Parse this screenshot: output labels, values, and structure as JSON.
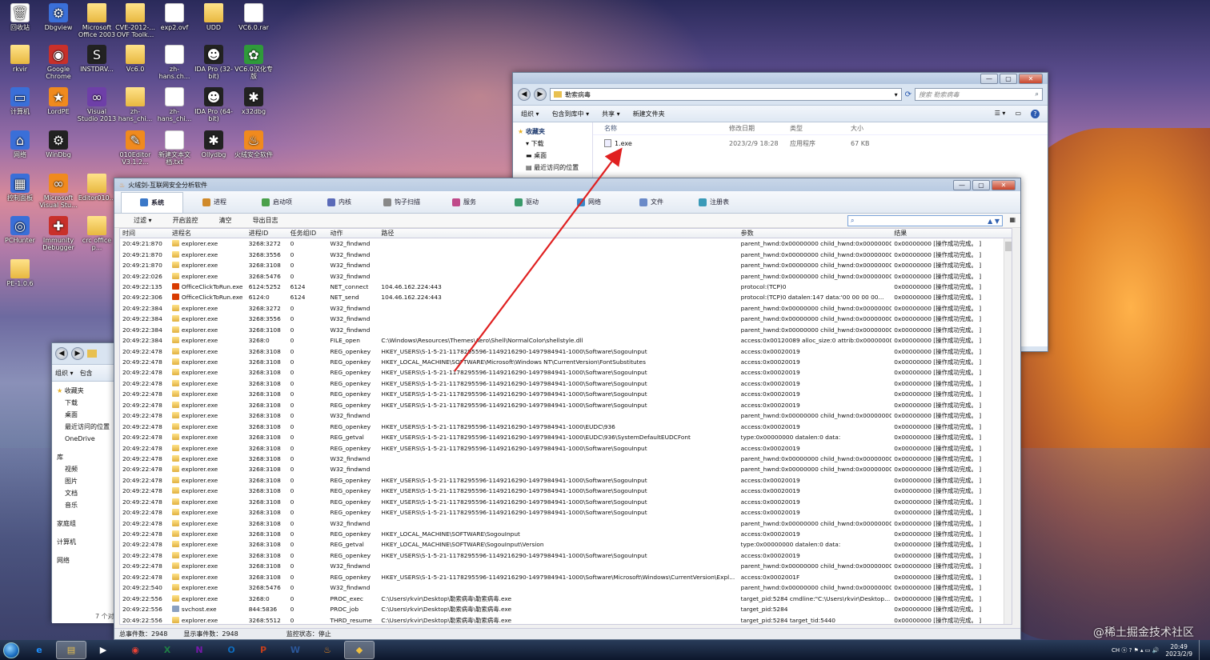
{
  "desktop": {
    "icons": [
      {
        "label": "回收站",
        "icon": "recycle-bin-icon",
        "cls": "file",
        "glyph": "🗑"
      },
      {
        "label": "Dbgview",
        "icon": "dbgview-icon",
        "cls": "app",
        "glyph": "⚙"
      },
      {
        "label": "Microsoft Office 2003",
        "icon": "folder-icon",
        "cls": "folder",
        "glyph": ""
      },
      {
        "label": "CVE-2012-... OVF Toolk...",
        "icon": "folder-icon",
        "cls": "folder",
        "glyph": ""
      },
      {
        "label": "exp2.ovf",
        "icon": "file-icon",
        "cls": "file",
        "glyph": ""
      },
      {
        "label": "UDD",
        "icon": "folder-icon",
        "cls": "folder",
        "glyph": ""
      },
      {
        "label": "VC6.0.rar",
        "icon": "file-icon",
        "cls": "file",
        "glyph": ""
      },
      {
        "label": "rkvir",
        "icon": "user-folder-icon",
        "cls": "folder",
        "glyph": ""
      },
      {
        "label": "Google Chrome",
        "icon": "chrome-icon",
        "cls": "red",
        "glyph": "◉"
      },
      {
        "label": "INSTDRV...",
        "icon": "instdrv-icon",
        "cls": "dark",
        "glyph": "S"
      },
      {
        "label": "Vc6.0",
        "icon": "folder-icon",
        "cls": "folder",
        "glyph": ""
      },
      {
        "label": "zh-hans.ch...",
        "icon": "file-icon",
        "cls": "file",
        "glyph": ""
      },
      {
        "label": "IDA Pro (32-bit)",
        "icon": "ida-icon",
        "cls": "dark",
        "glyph": "☻"
      },
      {
        "label": "VC6.0汉化专版",
        "icon": "vc6-icon",
        "cls": "green",
        "glyph": "✿"
      },
      {
        "label": "计算机",
        "icon": "computer-icon",
        "cls": "app",
        "glyph": "▭"
      },
      {
        "label": "LordPE",
        "icon": "lordpe-icon",
        "cls": "orange",
        "glyph": "★"
      },
      {
        "label": "Visual Studio 2013",
        "icon": "visual-studio-icon",
        "cls": "purple",
        "glyph": "∞"
      },
      {
        "label": "zh-hans_chi...",
        "icon": "folder-icon",
        "cls": "folder",
        "glyph": ""
      },
      {
        "label": "zh-hans_chi...",
        "icon": "file-icon",
        "cls": "file",
        "glyph": ""
      },
      {
        "label": "IDA Pro (64-bit)",
        "icon": "ida-icon",
        "cls": "dark",
        "glyph": "☻"
      },
      {
        "label": "x32dbg",
        "icon": "x32dbg-icon",
        "cls": "dark",
        "glyph": "✱"
      },
      {
        "label": "网络",
        "icon": "network-icon",
        "cls": "app",
        "glyph": "⌂"
      },
      {
        "label": "WinDbg",
        "icon": "windbg-icon",
        "cls": "dark",
        "glyph": "⚙"
      },
      {
        "label": "010Editor V3.1.2...",
        "icon": "010editor-icon",
        "cls": "orange",
        "glyph": "✎"
      },
      {
        "label": "新建文本文档.txt",
        "icon": "file-icon",
        "cls": "file",
        "glyph": ""
      },
      {
        "label": "Ollydbg",
        "icon": "ollydbg-icon",
        "cls": "dark",
        "glyph": "✱"
      },
      {
        "label": "火绒安全软件",
        "icon": "huorong-icon",
        "cls": "orange",
        "glyph": "♨"
      },
      {
        "label": "控制面板",
        "icon": "control-panel-icon",
        "cls": "app",
        "glyph": "▦"
      },
      {
        "label": "Microsoft Visual Stu...",
        "icon": "vs-icon",
        "cls": "orange",
        "glyph": "∞"
      },
      {
        "label": "Editor010...",
        "icon": "folder-icon",
        "cls": "folder",
        "glyph": ""
      },
      {
        "label": "PCHunter",
        "icon": "pchunter-icon",
        "cls": "app",
        "glyph": "◎"
      },
      {
        "label": "Immunity Debugger",
        "icon": "immunity-icon",
        "cls": "red",
        "glyph": "✚"
      },
      {
        "label": "crc office p...",
        "icon": "folder-icon",
        "cls": "folder",
        "glyph": ""
      },
      {
        "label": "PE-1.0.6",
        "icon": "folder-icon",
        "cls": "folder",
        "glyph": ""
      }
    ]
  },
  "explorer": {
    "address": "勒索病毒",
    "search_placeholder": "搜索 勒索病毒",
    "cmd": [
      "组织 ▾",
      "包含到库中 ▾",
      "共享 ▾",
      "新建文件夹"
    ],
    "nav": {
      "fav": "收藏夹",
      "items": [
        "下载",
        "桌面",
        "最近访问的位置"
      ]
    },
    "headers": [
      "名称",
      "修改日期",
      "类型",
      "大小"
    ],
    "files": [
      {
        "name": "1.exe",
        "date": "2023/2/9 18:28",
        "type": "应用程序",
        "size": "67 KB"
      }
    ]
  },
  "explorer2": {
    "cmd": [
      "组织 ▾",
      "包含"
    ],
    "nav": {
      "fav": "收藏夹",
      "items": [
        "下载",
        "桌面",
        "最近访问的位置",
        "OneDrive"
      ],
      "lib": "库",
      "libitems": [
        "视频",
        "图片",
        "文档",
        "音乐"
      ],
      "homegroup": "家庭组",
      "computer": "计算机",
      "network": "网络"
    },
    "count": "7 个对"
  },
  "tool": {
    "title": "火绒剑-互联网安全分析软件",
    "tabs": [
      {
        "label": "系统",
        "color": "#3a78c8"
      },
      {
        "label": "进程",
        "color": "#d08a2a"
      },
      {
        "label": "启动项",
        "color": "#4aa04a"
      },
      {
        "label": "内核",
        "color": "#5a6ab8"
      },
      {
        "label": "钩子扫描",
        "color": "#888888"
      },
      {
        "label": "服务",
        "color": "#c04a8a"
      },
      {
        "label": "驱动",
        "color": "#3a9a6a"
      },
      {
        "label": "网络",
        "color": "#3a88c8"
      },
      {
        "label": "文件",
        "color": "#6a8ac8"
      },
      {
        "label": "注册表",
        "color": "#3a9ab8"
      }
    ],
    "toolbar": [
      "过滤 ▾",
      "开启监控",
      "清空",
      "导出日志"
    ],
    "columns": [
      "时间",
      "进程名",
      "进程ID",
      "任务组ID",
      "动作",
      "路径",
      "参数",
      "结果"
    ],
    "rows": [
      [
        "20:49:21:870",
        "explorer.exe",
        "3268:3272",
        "0",
        "W32_findwnd",
        "",
        "parent_hwnd:0x00000000 child_hwnd:0x00000000...",
        "0x00000000 [操作成功完成。 ]",
        "folder"
      ],
      [
        "20:49:21:870",
        "explorer.exe",
        "3268:3556",
        "0",
        "W32_findwnd",
        "",
        "parent_hwnd:0x00000000 child_hwnd:0x00000000...",
        "0x00000000 [操作成功完成。 ]",
        "folder"
      ],
      [
        "20:49:21:870",
        "explorer.exe",
        "3268:3108",
        "0",
        "W32_findwnd",
        "",
        "parent_hwnd:0x00000000 child_hwnd:0x00000000...",
        "0x00000000 [操作成功完成。 ]",
        "folder"
      ],
      [
        "20:49:22:026",
        "explorer.exe",
        "3268:5476",
        "0",
        "W32_findwnd",
        "",
        "parent_hwnd:0x00000000 child_hwnd:0x00000000...",
        "0x00000000 [操作成功完成。 ]",
        "folder"
      ],
      [
        "20:49:22:135",
        "OfficeClickToRun.exe",
        "6124:5252",
        "6124",
        "NET_connect",
        "104.46.162.224:443",
        "protocol:(TCP)0",
        "0x00000000 [操作成功完成。 ]",
        "office"
      ],
      [
        "20:49:22:306",
        "OfficeClickToRun.exe",
        "6124:0",
        "6124",
        "NET_send",
        "104.46.162.224:443",
        "protocol:(TCP)0 datalen:147 data:'00 00 00 00...",
        "0x00000000 [操作成功完成。 ]",
        "office"
      ],
      [
        "20:49:22:384",
        "explorer.exe",
        "3268:3272",
        "0",
        "W32_findwnd",
        "",
        "parent_hwnd:0x00000000 child_hwnd:0x00000000...",
        "0x00000000 [操作成功完成。 ]",
        "folder"
      ],
      [
        "20:49:22:384",
        "explorer.exe",
        "3268:3556",
        "0",
        "W32_findwnd",
        "",
        "parent_hwnd:0x00000000 child_hwnd:0x00000000...",
        "0x00000000 [操作成功完成。 ]",
        "folder"
      ],
      [
        "20:49:22:384",
        "explorer.exe",
        "3268:3108",
        "0",
        "W32_findwnd",
        "",
        "parent_hwnd:0x00000000 child_hwnd:0x00000000...",
        "0x00000000 [操作成功完成。 ]",
        "folder"
      ],
      [
        "20:49:22:384",
        "explorer.exe",
        "3268:0",
        "0",
        "FILE_open",
        "C:\\Windows\\Resources\\Themes\\Aero\\Shell\\NormalColor\\shellstyle.dll",
        "access:0x00120089 alloc_size:0 attrib:0x00000000...",
        "0x00000000 [操作成功完成。 ]",
        "folder"
      ],
      [
        "20:49:22:478",
        "explorer.exe",
        "3268:3108",
        "0",
        "REG_openkey",
        "HKEY_USERS\\S-1-5-21-1178295596-1149216290-1497984941-1000\\Software\\SogouInput",
        "access:0x00020019",
        "0x00000000 [操作成功完成。 ]",
        "folder"
      ],
      [
        "20:49:22:478",
        "explorer.exe",
        "3268:3108",
        "0",
        "REG_openkey",
        "HKEY_LOCAL_MACHINE\\SOFTWARE\\Microsoft\\Windows NT\\CurrentVersion\\FontSubstitutes",
        "access:0x00020019",
        "0x00000000 [操作成功完成。 ]",
        "folder"
      ],
      [
        "20:49:22:478",
        "explorer.exe",
        "3268:3108",
        "0",
        "REG_openkey",
        "HKEY_USERS\\S-1-5-21-1178295596-1149216290-1497984941-1000\\Software\\SogouInput",
        "access:0x00020019",
        "0x00000000 [操作成功完成。 ]",
        "folder"
      ],
      [
        "20:49:22:478",
        "explorer.exe",
        "3268:3108",
        "0",
        "REG_openkey",
        "HKEY_USERS\\S-1-5-21-1178295596-1149216290-1497984941-1000\\Software\\SogouInput",
        "access:0x00020019",
        "0x00000000 [操作成功完成。 ]",
        "folder"
      ],
      [
        "20:49:22:478",
        "explorer.exe",
        "3268:3108",
        "0",
        "REG_openkey",
        "HKEY_USERS\\S-1-5-21-1178295596-1149216290-1497984941-1000\\Software\\SogouInput",
        "access:0x00020019",
        "0x00000000 [操作成功完成。 ]",
        "folder"
      ],
      [
        "20:49:22:478",
        "explorer.exe",
        "3268:3108",
        "0",
        "REG_openkey",
        "HKEY_USERS\\S-1-5-21-1178295596-1149216290-1497984941-1000\\Software\\SogouInput",
        "access:0x00020019",
        "0x00000000 [操作成功完成。 ]",
        "folder"
      ],
      [
        "20:49:22:478",
        "explorer.exe",
        "3268:3108",
        "0",
        "W32_findwnd",
        "",
        "parent_hwnd:0x00000000 child_hwnd:0x00000000...",
        "0x00000000 [操作成功完成。 ]",
        "folder"
      ],
      [
        "20:49:22:478",
        "explorer.exe",
        "3268:3108",
        "0",
        "REG_openkey",
        "HKEY_USERS\\S-1-5-21-1178295596-1149216290-1497984941-1000\\EUDC\\936",
        "access:0x00020019",
        "0x00000000 [操作成功完成。 ]",
        "folder"
      ],
      [
        "20:49:22:478",
        "explorer.exe",
        "3268:3108",
        "0",
        "REG_getval",
        "HKEY_USERS\\S-1-5-21-1178295596-1149216290-1497984941-1000\\EUDC\\936\\SystemDefaultEUDCFont",
        "type:0x00000000 datalen:0 data:",
        "0x00000000 [操作成功完成。 ]",
        "folder"
      ],
      [
        "20:49:22:478",
        "explorer.exe",
        "3268:3108",
        "0",
        "REG_openkey",
        "HKEY_USERS\\S-1-5-21-1178295596-1149216290-1497984941-1000\\Software\\SogouInput",
        "access:0x00020019",
        "0x00000000 [操作成功完成。 ]",
        "folder"
      ],
      [
        "20:49:22:478",
        "explorer.exe",
        "3268:3108",
        "0",
        "W32_findwnd",
        "",
        "parent_hwnd:0x00000000 child_hwnd:0x00000000...",
        "0x00000000 [操作成功完成。 ]",
        "folder"
      ],
      [
        "20:49:22:478",
        "explorer.exe",
        "3268:3108",
        "0",
        "W32_findwnd",
        "",
        "parent_hwnd:0x00000000 child_hwnd:0x00000000...",
        "0x00000000 [操作成功完成。 ]",
        "folder"
      ],
      [
        "20:49:22:478",
        "explorer.exe",
        "3268:3108",
        "0",
        "REG_openkey",
        "HKEY_USERS\\S-1-5-21-1178295596-1149216290-1497984941-1000\\Software\\SogouInput",
        "access:0x00020019",
        "0x00000000 [操作成功完成。 ]",
        "folder"
      ],
      [
        "20:49:22:478",
        "explorer.exe",
        "3268:3108",
        "0",
        "REG_openkey",
        "HKEY_USERS\\S-1-5-21-1178295596-1149216290-1497984941-1000\\Software\\SogouInput",
        "access:0x00020019",
        "0x00000000 [操作成功完成。 ]",
        "folder"
      ],
      [
        "20:49:22:478",
        "explorer.exe",
        "3268:3108",
        "0",
        "REG_openkey",
        "HKEY_USERS\\S-1-5-21-1178295596-1149216290-1497984941-1000\\Software\\SogouInput",
        "access:0x00020019",
        "0x00000000 [操作成功完成。 ]",
        "folder"
      ],
      [
        "20:49:22:478",
        "explorer.exe",
        "3268:3108",
        "0",
        "REG_openkey",
        "HKEY_USERS\\S-1-5-21-1178295596-1149216290-1497984941-1000\\Software\\SogouInput",
        "access:0x00020019",
        "0x00000000 [操作成功完成。 ]",
        "folder"
      ],
      [
        "20:49:22:478",
        "explorer.exe",
        "3268:3108",
        "0",
        "W32_findwnd",
        "",
        "parent_hwnd:0x00000000 child_hwnd:0x00000000...",
        "0x00000000 [操作成功完成。 ]",
        "folder"
      ],
      [
        "20:49:22:478",
        "explorer.exe",
        "3268:3108",
        "0",
        "REG_openkey",
        "HKEY_LOCAL_MACHINE\\SOFTWARE\\SogouInput",
        "access:0x00020019",
        "0x00000000 [操作成功完成。 ]",
        "folder"
      ],
      [
        "20:49:22:478",
        "explorer.exe",
        "3268:3108",
        "0",
        "REG_getval",
        "HKEY_LOCAL_MACHINE\\SOFTWARE\\SogouInput\\Version",
        "type:0x00000000 datalen:0 data:",
        "0x00000000 [操作成功完成。 ]",
        "folder"
      ],
      [
        "20:49:22:478",
        "explorer.exe",
        "3268:3108",
        "0",
        "REG_openkey",
        "HKEY_USERS\\S-1-5-21-1178295596-1149216290-1497984941-1000\\Software\\SogouInput",
        "access:0x00020019",
        "0x00000000 [操作成功完成。 ]",
        "folder"
      ],
      [
        "20:49:22:478",
        "explorer.exe",
        "3268:3108",
        "0",
        "W32_findwnd",
        "",
        "parent_hwnd:0x00000000 child_hwnd:0x00000000...",
        "0x00000000 [操作成功完成。 ]",
        "folder"
      ],
      [
        "20:49:22:478",
        "explorer.exe",
        "3268:3108",
        "0",
        "REG_openkey",
        "HKEY_USERS\\S-1-5-21-1178295596-1149216290-1497984941-1000\\Software\\Microsoft\\Windows\\CurrentVersion\\Expl...",
        "access:0x0002001F",
        "0x00000000 [操作成功完成。 ]",
        "folder"
      ],
      [
        "20:49:22:540",
        "explorer.exe",
        "3268:5476",
        "0",
        "W32_findwnd",
        "",
        "parent_hwnd:0x00000000 child_hwnd:0x00000000...",
        "0x00000000 [操作成功完成。 ]",
        "folder"
      ],
      [
        "20:49:22:556",
        "explorer.exe",
        "3268:0",
        "0",
        "PROC_exec",
        "C:\\Users\\rkvir\\Desktop\\勒索病毒\\勒索病毒.exe",
        "target_pid:5284 cmdline:\"C:\\Users\\rkvir\\Desktop...",
        "0x00000000 [操作成功完成。 ]",
        "folder"
      ],
      [
        "20:49:22:556",
        "svchost.exe",
        "844:5836",
        "0",
        "PROC_job",
        "C:\\Users\\rkvir\\Desktop\\勒索病毒\\勒索病毒.exe",
        "target_pid:5284",
        "0x00000000 [操作成功完成。 ]",
        "svc"
      ],
      [
        "20:49:22:556",
        "explorer.exe",
        "3268:5512",
        "0",
        "THRD_resume",
        "C:\\Users\\rkvir\\Desktop\\勒索病毒\\勒索病毒.exe",
        "target_pid:5284 target_tid:5440",
        "0x00000000 [操作成功完成。 ]",
        "folder"
      ]
    ],
    "status": [
      "总事件数：2948",
      "显示事件数：2948",
      "监控状态：停止"
    ]
  },
  "taskbar": {
    "apps": [
      {
        "glyph": "e",
        "color": "#1e90ff",
        "name": "ie-icon"
      },
      {
        "glyph": "▤",
        "color": "#e8c050",
        "name": "explorer-taskbar-icon"
      },
      {
        "glyph": "▶",
        "color": "#ffffff",
        "name": "media-player-icon"
      },
      {
        "glyph": "◉",
        "color": "#ea4335",
        "name": "chrome-taskbar-icon"
      },
      {
        "glyph": "X",
        "color": "#1e7e45",
        "name": "excel-icon"
      },
      {
        "glyph": "N",
        "color": "#7719aa",
        "name": "onenote-icon"
      },
      {
        "glyph": "O",
        "color": "#0f6cbd",
        "name": "outlook-icon"
      },
      {
        "glyph": "P",
        "color": "#c43e1c",
        "name": "powerpoint-icon"
      },
      {
        "glyph": "W",
        "color": "#2b579a",
        "name": "word-icon"
      },
      {
        "glyph": "♨",
        "color": "#f08a1e",
        "name": "huorong-taskbar-icon"
      },
      {
        "glyph": "◆",
        "color": "#f0c040",
        "name": "huorongjian-taskbar-icon"
      }
    ],
    "tray": "CH ⓢ ? ⚑ ▴ ▭ 🔊",
    "time": "20:49",
    "date": "2023/2/9"
  },
  "watermark": "@稀土掘金技术社区"
}
